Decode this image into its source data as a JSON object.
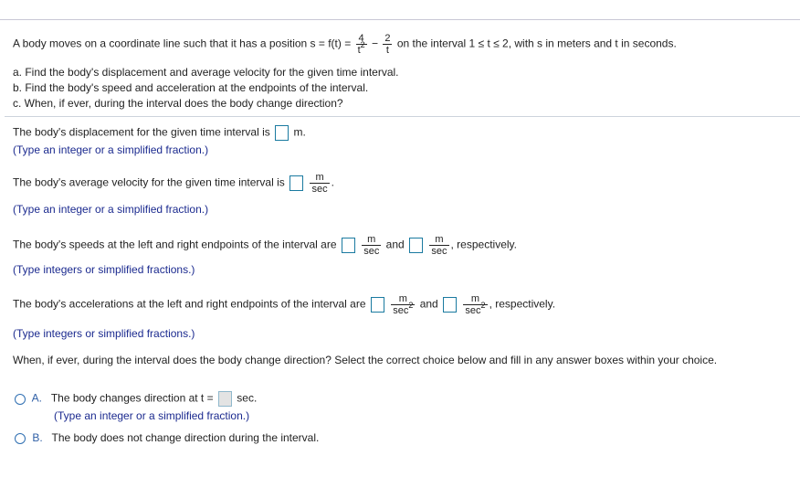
{
  "problem": {
    "intro_pre": "A body moves on a coordinate line such that it has a position s = f(t) =",
    "term1_num": "4",
    "term1_den": "t",
    "term1_den_exp": "2",
    "minus": "−",
    "term2_num": "2",
    "term2_den": "t",
    "intro_post": "on the interval 1 ≤ t ≤ 2, with s in meters and t in seconds.",
    "part_a": "a. Find the body's displacement and average velocity for the given time interval.",
    "part_b": "b. Find the body's speed and acceleration at the endpoints of the interval.",
    "part_c": "c. When, if ever, during the interval does the body change direction?"
  },
  "q_displacement": {
    "text": "The body's displacement for the given time interval is",
    "unit": "m.",
    "hint": "(Type an integer or a simplified fraction.)",
    "value": ""
  },
  "q_avg_velocity": {
    "text": "The body's average velocity for the given time interval is",
    "unit_num": "m",
    "unit_den": "sec",
    "after": ".",
    "hint": "(Type an integer or a simplified fraction.)",
    "value": ""
  },
  "q_speeds": {
    "text": "The body's speeds at the left and right endpoints of the interval are",
    "unit_num": "m",
    "unit_den": "sec",
    "and": "and",
    "after": ", respectively.",
    "hint": "(Type integers or simplified fractions.)",
    "left_value": "",
    "right_value": ""
  },
  "q_accel": {
    "text": "The body's accelerations at the left and right endpoints of the interval are",
    "unit_num": "m",
    "unit_den": "sec",
    "unit_den_exp": "2",
    "and": "and",
    "after": ", respectively.",
    "hint": "(Type integers or simplified fractions.)",
    "left_value": "",
    "right_value": ""
  },
  "q_direction": {
    "text": "When, if ever, during the interval does the body change direction? Select the correct choice below and fill in any answer boxes within your choice.",
    "choice_a": {
      "letter": "A.",
      "text": "The body changes direction at t =",
      "unit": "sec.",
      "hint": "(Type an integer or a simplified fraction.)",
      "value": ""
    },
    "choice_b": {
      "letter": "B.",
      "text": "The body does not change direction during the interval."
    }
  }
}
